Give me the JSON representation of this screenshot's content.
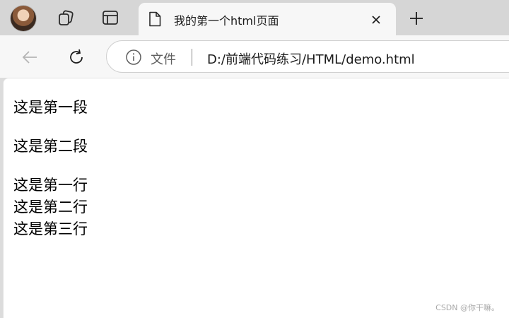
{
  "tab": {
    "title": "我的第一个html页面"
  },
  "toolbar": {
    "site_label": "文件",
    "url": "D:/前端代码练习/HTML/demo.html"
  },
  "page": {
    "paragraph_1": "这是第一段",
    "paragraph_2": "这是第二段",
    "lines": [
      "这是第一行",
      "这是第二行",
      "这是第三行"
    ]
  },
  "watermark": "CSDN @你干嘛。",
  "icons": {
    "avatar": "profile-avatar",
    "workspaces": "workspaces-icon",
    "tab_actions": "tab-actions-icon",
    "page": "page-icon",
    "close": "close-icon",
    "new_tab": "plus-icon",
    "back": "back-arrow-icon",
    "refresh": "refresh-icon",
    "info": "info-icon"
  }
}
